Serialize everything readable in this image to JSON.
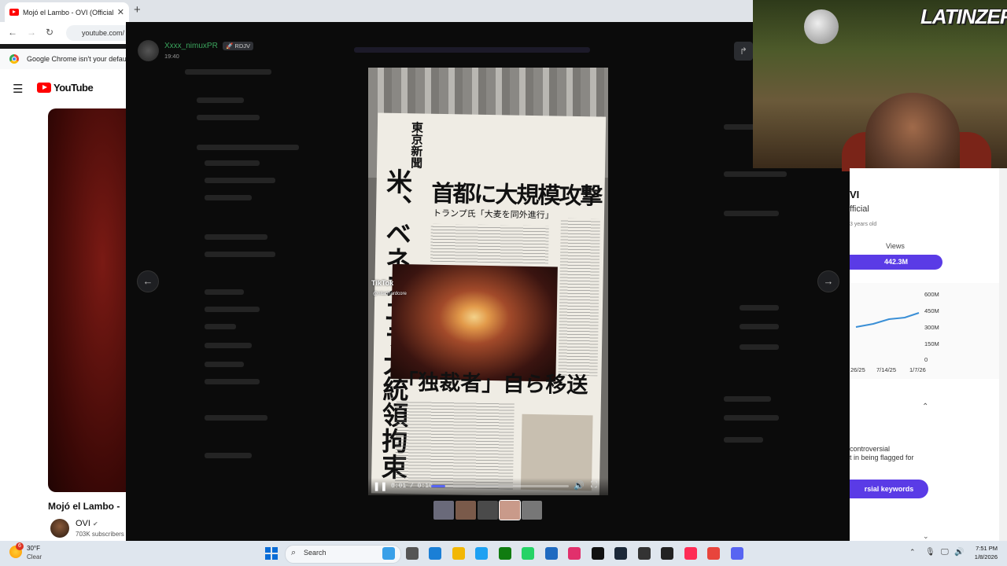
{
  "browser": {
    "tab_title": "Mojó el Lambo - OVI (Official V",
    "tab_close": "✕",
    "new_tab": "+",
    "url": "youtube.com/",
    "back": "←",
    "forward": "→",
    "reload": "↻",
    "info_bar": "Google Chrome isn't your default browser"
  },
  "youtube": {
    "menu_icon": "☰",
    "logo_text": "YouTube",
    "video_title": "Mojó el Lambo -",
    "channel_name": "OVI",
    "verified": "✔",
    "subscribers": "703K subscribers"
  },
  "viewer": {
    "username": "Xxxx_nimuxPR",
    "role_badge": "🚀 RDJV",
    "timestamp": "19:40",
    "share_icon": "↱",
    "prev_arrow": "←",
    "next_arrow": "→",
    "video": {
      "tiktok_watermark": "TikTok",
      "tiktok_user": "@nitanhardcore",
      "newspaper_masthead": "東京新聞",
      "headline_main": "首都に大規模攻撃",
      "headline_vertical": "米、ベネズエラ大統領拘束",
      "headline_bottom": "「独裁者」自ら移送",
      "subhead": "トランプ氏「大麦を同外進行」",
      "time_current": "0:01",
      "time_separator": "/",
      "time_total": "0:10",
      "progress": 0.1,
      "play_icon": "❚❚",
      "volume_icon": "🔊",
      "fullscreen_icon": "⛶"
    },
    "thumbnail_colors": [
      "#6a6a7a",
      "#7a5a4a",
      "#4a4a4a",
      "#c99a8a",
      "#777777"
    ]
  },
  "webcam": {
    "logo_text": "LATINZER"
  },
  "stats_panel": {
    "name": "VI",
    "official": "fficial",
    "age": "3 years old",
    "views_label": "Views",
    "views_value": "442.3M",
    "y_ticks": [
      "600M",
      "450M",
      "300M",
      "150M",
      "0"
    ],
    "x_ticks": [
      "26/25",
      "7/14/25",
      "1/7/26"
    ],
    "warning_line1": "controversial",
    "warning_line2": "t in being flagged for",
    "cta": "rsial keywords",
    "chevron_up": "⌃",
    "chevron_down": "⌄",
    "accent_color": "#5a3be6"
  },
  "taskbar": {
    "weather_badge": "6",
    "temperature": "30°F",
    "condition": "Clear",
    "search_placeholder": "Search",
    "search_icon": "⌕",
    "tray_up": "⌃",
    "time": "7:51 PM",
    "date": "1/8/2026",
    "app_icon_colors": [
      "#3aa0e8",
      "#555555",
      "#1a7fd6",
      "#f2b705",
      "#1da1f2",
      "#107c10",
      "#25d366",
      "#1f6ac0",
      "#e1306c",
      "#111111",
      "#1b2838",
      "#333333",
      "#222222",
      "#fe2c55",
      "#e8453c",
      "#5865f2"
    ]
  }
}
